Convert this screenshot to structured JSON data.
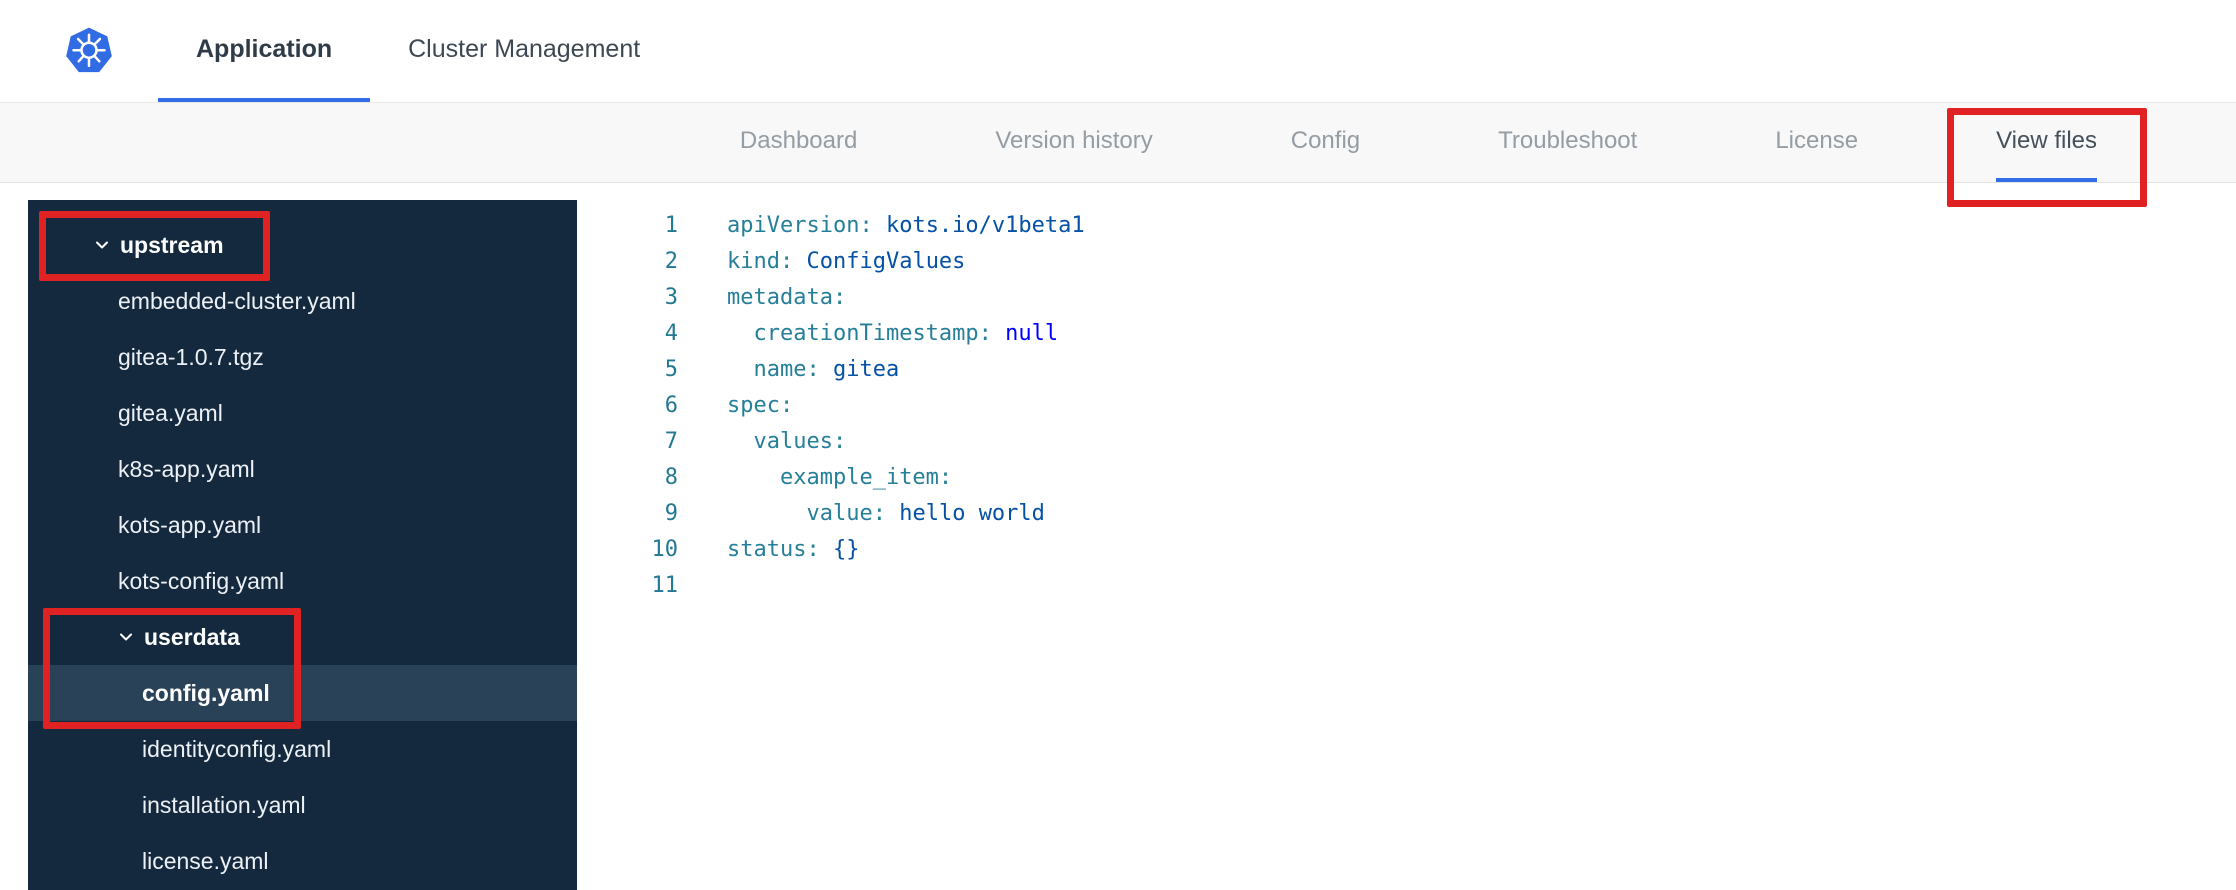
{
  "colors": {
    "accent_blue": "#326de6",
    "annotation_red": "#e02222",
    "sidebar_bg": "#14293e",
    "sidebar_selected_bg": "#2a4258",
    "code_key": "#267f99",
    "code_string": "#0451a5",
    "code_keyword": "#0000ff",
    "line_number": "#237893",
    "logo_blue": "#326ce5"
  },
  "header": {
    "logo_icon": "kubernetes-helm-wheel",
    "tabs": [
      {
        "label": "Application",
        "active": true
      },
      {
        "label": "Cluster Management",
        "active": false
      }
    ]
  },
  "subnav": {
    "items": [
      {
        "label": "Dashboard",
        "active": false
      },
      {
        "label": "Version history",
        "active": false
      },
      {
        "label": "Config",
        "active": false
      },
      {
        "label": "Troubleshoot",
        "active": false
      },
      {
        "label": "License",
        "active": false
      },
      {
        "label": "View files",
        "active": true,
        "annotated": true
      }
    ]
  },
  "file_tree": {
    "items": [
      {
        "label": "upstream",
        "kind": "folder",
        "expanded": true,
        "level": 0,
        "annotated": true
      },
      {
        "label": "embedded-cluster.yaml",
        "kind": "file",
        "level": 1
      },
      {
        "label": "gitea-1.0.7.tgz",
        "kind": "file",
        "level": 1
      },
      {
        "label": "gitea.yaml",
        "kind": "file",
        "level": 1
      },
      {
        "label": "k8s-app.yaml",
        "kind": "file",
        "level": 1
      },
      {
        "label": "kots-app.yaml",
        "kind": "file",
        "level": 1
      },
      {
        "label": "kots-config.yaml",
        "kind": "file",
        "level": 1
      },
      {
        "label": "userdata",
        "kind": "folder",
        "expanded": true,
        "level": 1,
        "annotated": true
      },
      {
        "label": "config.yaml",
        "kind": "file",
        "level": 2,
        "selected": true,
        "annotated": true
      },
      {
        "label": "identityconfig.yaml",
        "kind": "file",
        "level": 2
      },
      {
        "label": "installation.yaml",
        "kind": "file",
        "level": 2
      },
      {
        "label": "license.yaml",
        "kind": "file",
        "level": 2
      }
    ]
  },
  "editor": {
    "language": "yaml",
    "lines": [
      {
        "num": "1",
        "tokens": [
          [
            "key",
            "apiVersion:"
          ],
          [
            "pl",
            " "
          ],
          [
            "str",
            "kots.io/v1beta1"
          ]
        ]
      },
      {
        "num": "2",
        "tokens": [
          [
            "key",
            "kind:"
          ],
          [
            "pl",
            " "
          ],
          [
            "str",
            "ConfigValues"
          ]
        ]
      },
      {
        "num": "3",
        "tokens": [
          [
            "key",
            "metadata:"
          ]
        ]
      },
      {
        "num": "4",
        "tokens": [
          [
            "pl",
            "  "
          ],
          [
            "key",
            "creationTimestamp:"
          ],
          [
            "pl",
            " "
          ],
          [
            "kw",
            "null"
          ]
        ]
      },
      {
        "num": "5",
        "tokens": [
          [
            "pl",
            "  "
          ],
          [
            "key",
            "name:"
          ],
          [
            "pl",
            " "
          ],
          [
            "str",
            "gitea"
          ]
        ]
      },
      {
        "num": "6",
        "tokens": [
          [
            "key",
            "spec:"
          ]
        ]
      },
      {
        "num": "7",
        "tokens": [
          [
            "pl",
            "  "
          ],
          [
            "key",
            "values:"
          ]
        ]
      },
      {
        "num": "8",
        "tokens": [
          [
            "pl",
            "    "
          ],
          [
            "key",
            "example_item:"
          ]
        ]
      },
      {
        "num": "9",
        "tokens": [
          [
            "pl",
            "      "
          ],
          [
            "key",
            "value:"
          ],
          [
            "pl",
            " "
          ],
          [
            "str",
            "hello world"
          ]
        ]
      },
      {
        "num": "10",
        "tokens": [
          [
            "key",
            "status:"
          ],
          [
            "pl",
            " "
          ],
          [
            "str",
            "{}"
          ]
        ]
      },
      {
        "num": "11",
        "tokens": []
      }
    ]
  },
  "annotations": [
    {
      "target": "view-files-tab"
    },
    {
      "target": "upstream-folder"
    },
    {
      "target": "userdata-and-config-yaml"
    }
  ]
}
